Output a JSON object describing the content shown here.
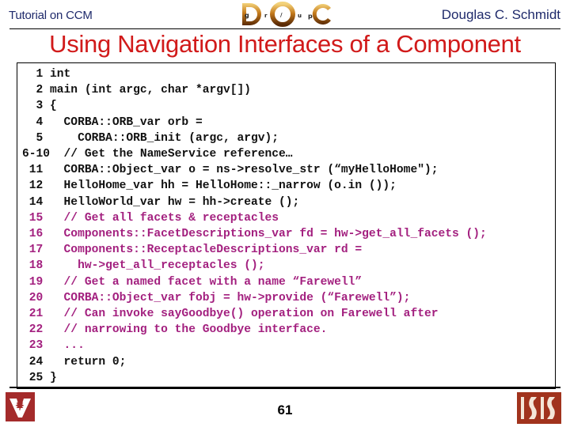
{
  "header": {
    "left_text": "Tutorial on CCM",
    "right_text": "Douglas C. Schmidt",
    "logo_letters": {
      "big": [
        "D",
        "O",
        "C"
      ],
      "small": [
        "g",
        "r",
        "/",
        "u",
        "p"
      ]
    }
  },
  "title": "Using Navigation Interfaces of a Component",
  "colors": {
    "title": "#d11a1a",
    "header_text": "#1f2a6b",
    "code_default": "#111111",
    "code_highlight": "#a3207f",
    "logo_maroon": "#a42b2b",
    "logo_isis": "#a1331d"
  },
  "code_lines": [
    {
      "num": "1",
      "indent": "",
      "text": "int",
      "color": "black"
    },
    {
      "num": "2",
      "indent": "",
      "text": "main (int argc, char *argv[])",
      "color": "black"
    },
    {
      "num": "3",
      "indent": "",
      "text": "{",
      "color": "black"
    },
    {
      "num": "4",
      "indent": "  ",
      "text": "CORBA::ORB_var orb =",
      "color": "black"
    },
    {
      "num": "5",
      "indent": "    ",
      "text": "CORBA::ORB_init (argc, argv);",
      "color": "black"
    },
    {
      "num": "6-10",
      "indent": " ",
      "text": "// Get the NameService reference…",
      "color": "black"
    },
    {
      "num": "11",
      "indent": "  ",
      "text": "CORBA::Object_var o = ns->resolve_str (“myHelloHome\");",
      "color": "black"
    },
    {
      "num": "12",
      "indent": "  ",
      "text": "HelloHome_var hh = HelloHome::_narrow (o.in ());",
      "color": "black"
    },
    {
      "num": "14",
      "indent": "  ",
      "text": "HelloWorld_var hw = hh->create ();",
      "color": "black"
    },
    {
      "num": "15",
      "indent": "  ",
      "text": "// Get all facets & receptacles",
      "color": "purple"
    },
    {
      "num": "16",
      "indent": "  ",
      "text": "Components::FacetDescriptions_var fd = hw->get_all_facets ();",
      "color": "purple"
    },
    {
      "num": "17",
      "indent": "  ",
      "text": "Components::ReceptacleDescriptions_var rd =",
      "color": "purple"
    },
    {
      "num": "18",
      "indent": "    ",
      "text": "hw->get_all_receptacles ();",
      "color": "purple"
    },
    {
      "num": "19",
      "indent": "  ",
      "text": "// Get a named facet with a name “Farewell”",
      "color": "purple"
    },
    {
      "num": "20",
      "indent": "  ",
      "text": "CORBA::Object_var fobj = hw->provide (“Farewell”);",
      "color": "purple"
    },
    {
      "num": "21",
      "indent": "  ",
      "text": "// Can invoke sayGoodbye() operation on Farewell after",
      "color": "purple"
    },
    {
      "num": "22",
      "indent": "  ",
      "text": "// narrowing to the Goodbye interface.",
      "color": "purple"
    },
    {
      "num": "23",
      "indent": "  ",
      "text": "...",
      "color": "purple"
    },
    {
      "num": "24",
      "indent": "  ",
      "text": "return 0;",
      "color": "black"
    },
    {
      "num": "25",
      "indent": "",
      "text": "}",
      "color": "black"
    }
  ],
  "footer": {
    "page_number": "61",
    "left_logo": "vanderbilt-logo",
    "right_logo": "isis-logo",
    "right_logo_text": "ISIS"
  }
}
